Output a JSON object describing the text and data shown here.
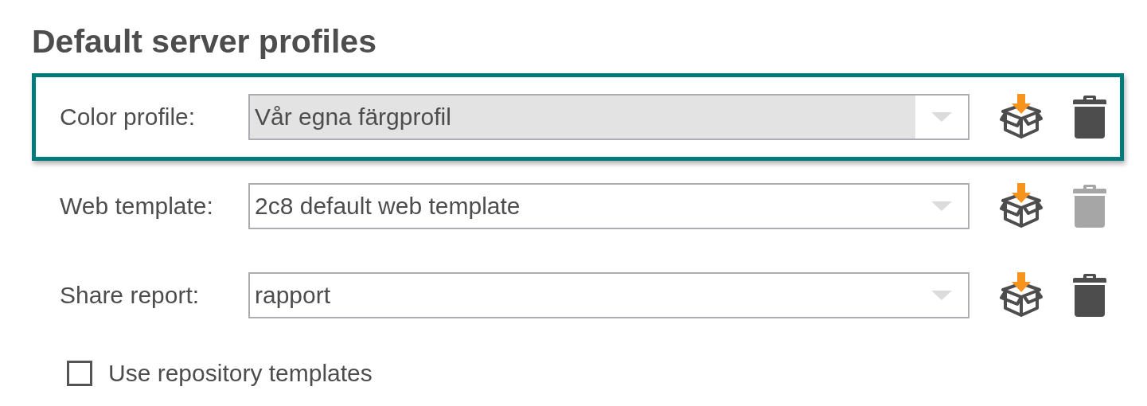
{
  "title": "Default server profiles",
  "rows": [
    {
      "label": "Color profile:",
      "value": "Vår egna färgprofil",
      "highlighted": true,
      "delete_disabled": false
    },
    {
      "label": "Web template:",
      "value": "2c8 default web template",
      "highlighted": false,
      "delete_disabled": true
    },
    {
      "label": "Share report:",
      "value": "rapport",
      "highlighted": false,
      "delete_disabled": false
    }
  ],
  "checkbox": {
    "label": "Use repository templates",
    "checked": false
  }
}
